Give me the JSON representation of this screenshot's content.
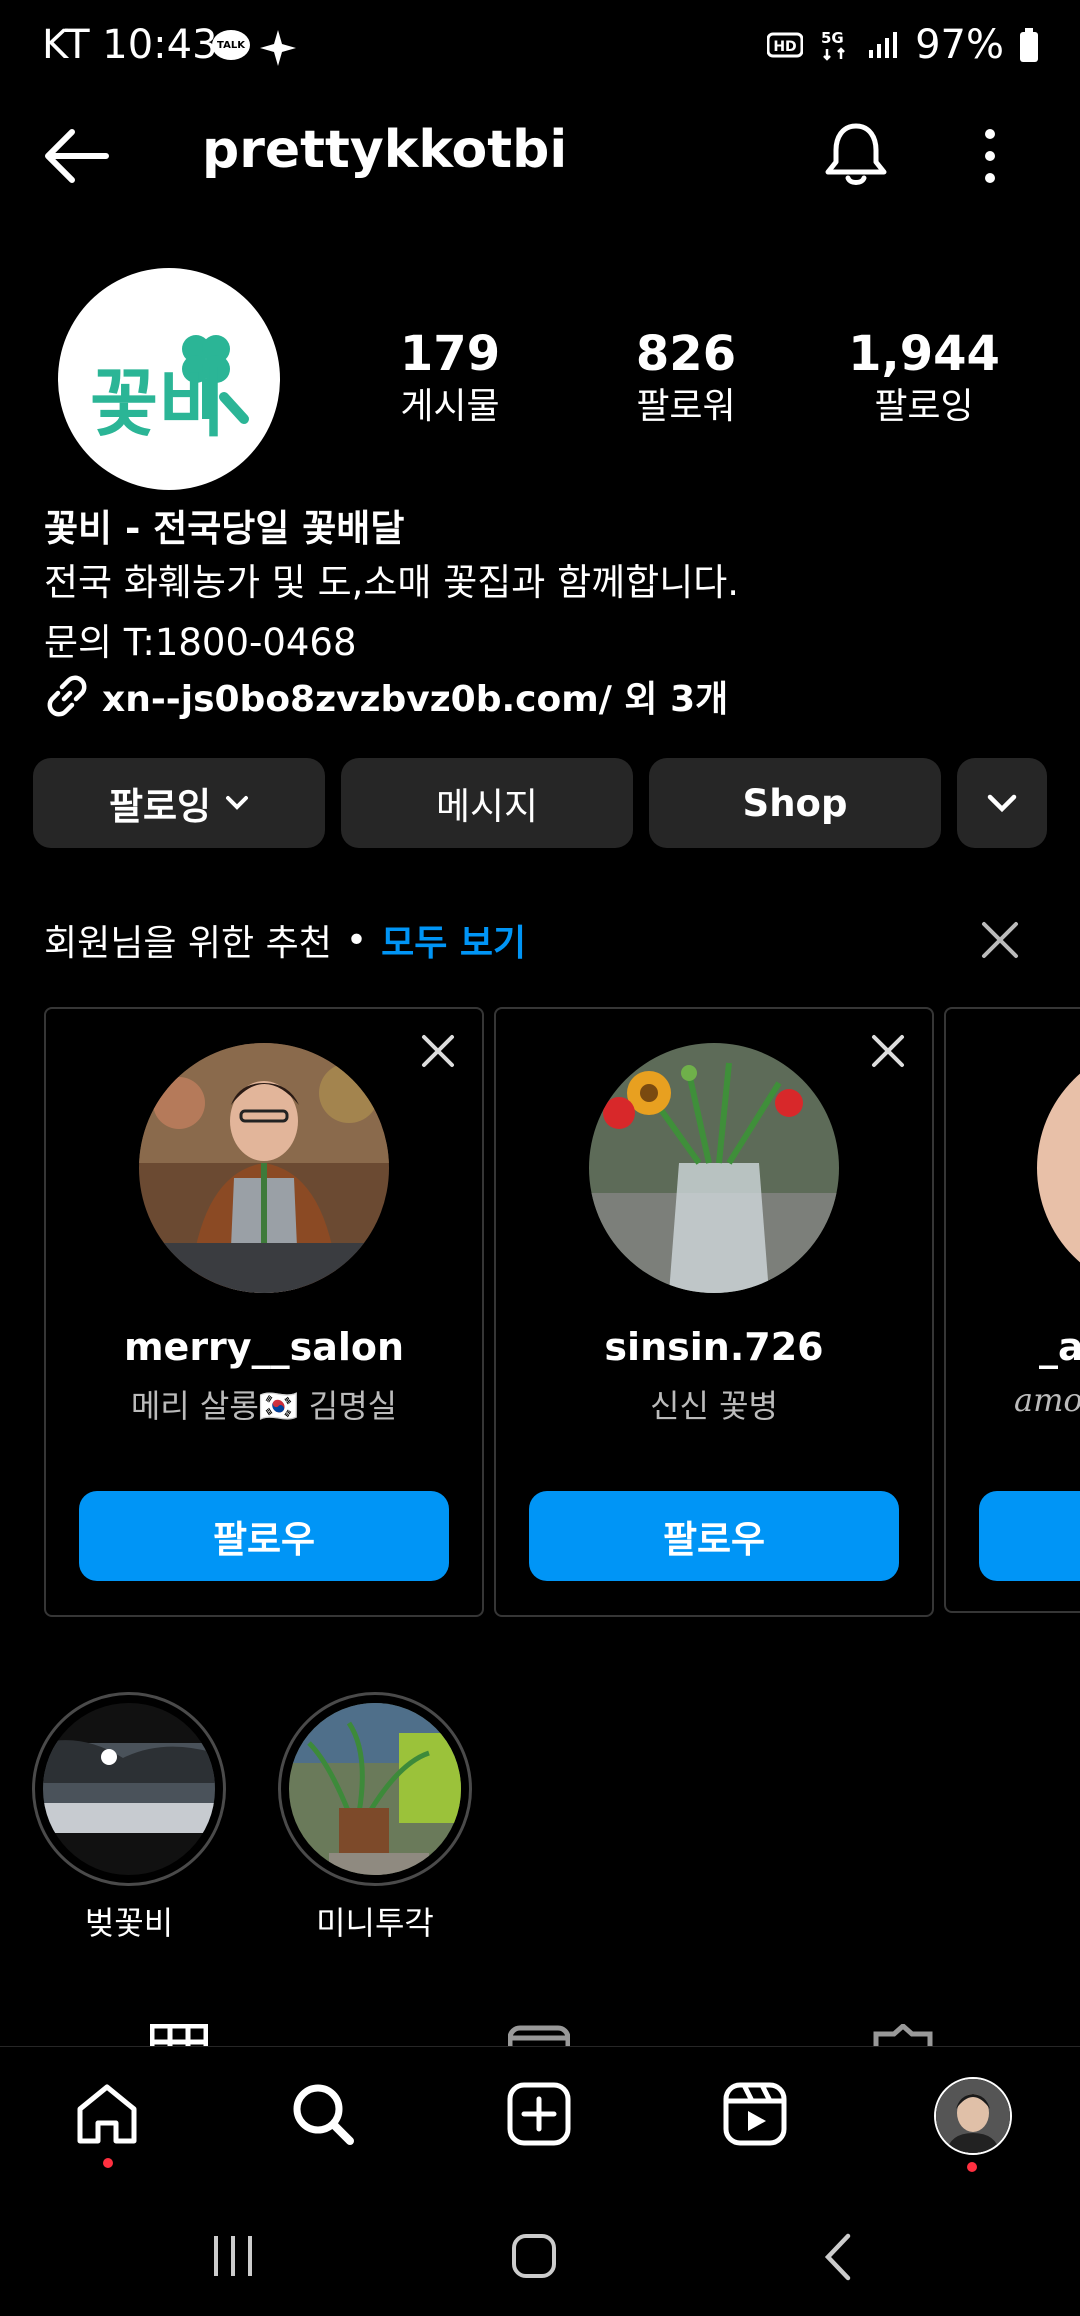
{
  "status_bar": {
    "carrier_time": "KT 10:43",
    "battery": "97%",
    "talk_badge": "TALK"
  },
  "header": {
    "username": "prettykkotbi"
  },
  "profile": {
    "logo_text": "꽃비",
    "stats": [
      {
        "value": "179",
        "label": "게시물"
      },
      {
        "value": "826",
        "label": "팔로워"
      },
      {
        "value": "1,944",
        "label": "팔로잉"
      }
    ],
    "bio_name": "꽃비 - 전국당일 꽃배달",
    "bio_line1": "전국 화훼농가 및 도,소매 꽃집과 함께합니다.",
    "bio_line2": "문의 T:1800-0468",
    "link": "xn--js0bo8zvzbvz0b.com/ 외 3개"
  },
  "actions": {
    "following": "팔로잉",
    "message": "메시지",
    "shop": "Shop"
  },
  "suggestions": {
    "title": "회원님을 위한 추천",
    "see_all": "모두 보기",
    "cards": [
      {
        "username": "merry__salon",
        "subtitle": "메리 살롱🇰🇷  김명실",
        "follow": "팔로우"
      },
      {
        "username": "sinsin.726",
        "subtitle": "신신 꽃병",
        "follow": "팔로우"
      },
      {
        "username": "_a",
        "subtitle": "amo",
        "follow": ""
      }
    ]
  },
  "highlights": [
    {
      "label": "벚꽃비"
    },
    {
      "label": "미니투각"
    }
  ],
  "colors": {
    "accent": "#0095f6",
    "logo_green": "#2bb596",
    "button_bg": "#262626",
    "badge_red": "#ff3040"
  }
}
